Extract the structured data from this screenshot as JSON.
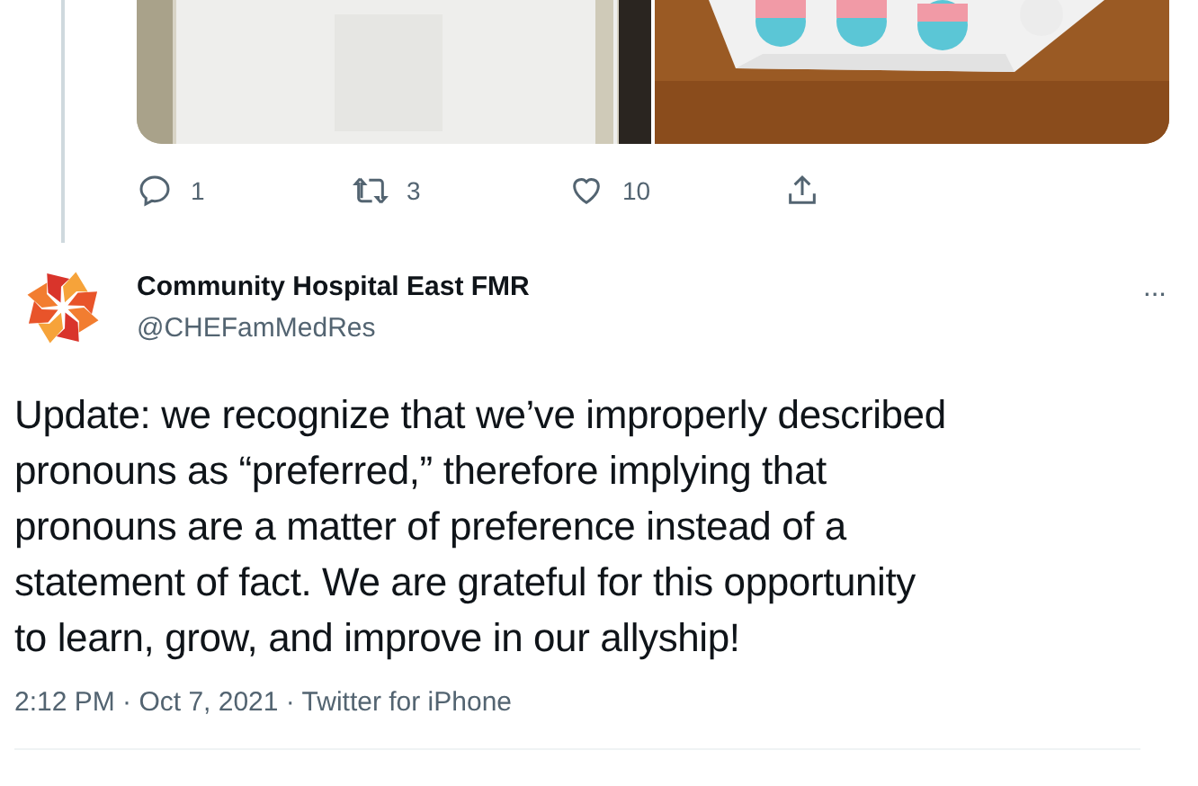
{
  "actions": [
    {
      "kind": "reply",
      "count": "1"
    },
    {
      "kind": "retweet",
      "count": "3"
    },
    {
      "kind": "like",
      "count": "10"
    },
    {
      "kind": "share"
    }
  ],
  "author": {
    "name": "Community Hospital East FMR",
    "handle": "@CHEFamMedRes",
    "more": "···"
  },
  "tweet_text": "Update: we recognize that we’ve improperly described\npronouns as “preferred,” therefore implying that\npronouns are a matter of preference instead of a\nstatement of fact. We are grateful for this opportunity\nto learn, grow, and improve in our allyship!",
  "meta": "2:12 PM · Oct 7, 2021 · Twitter for iPhone"
}
